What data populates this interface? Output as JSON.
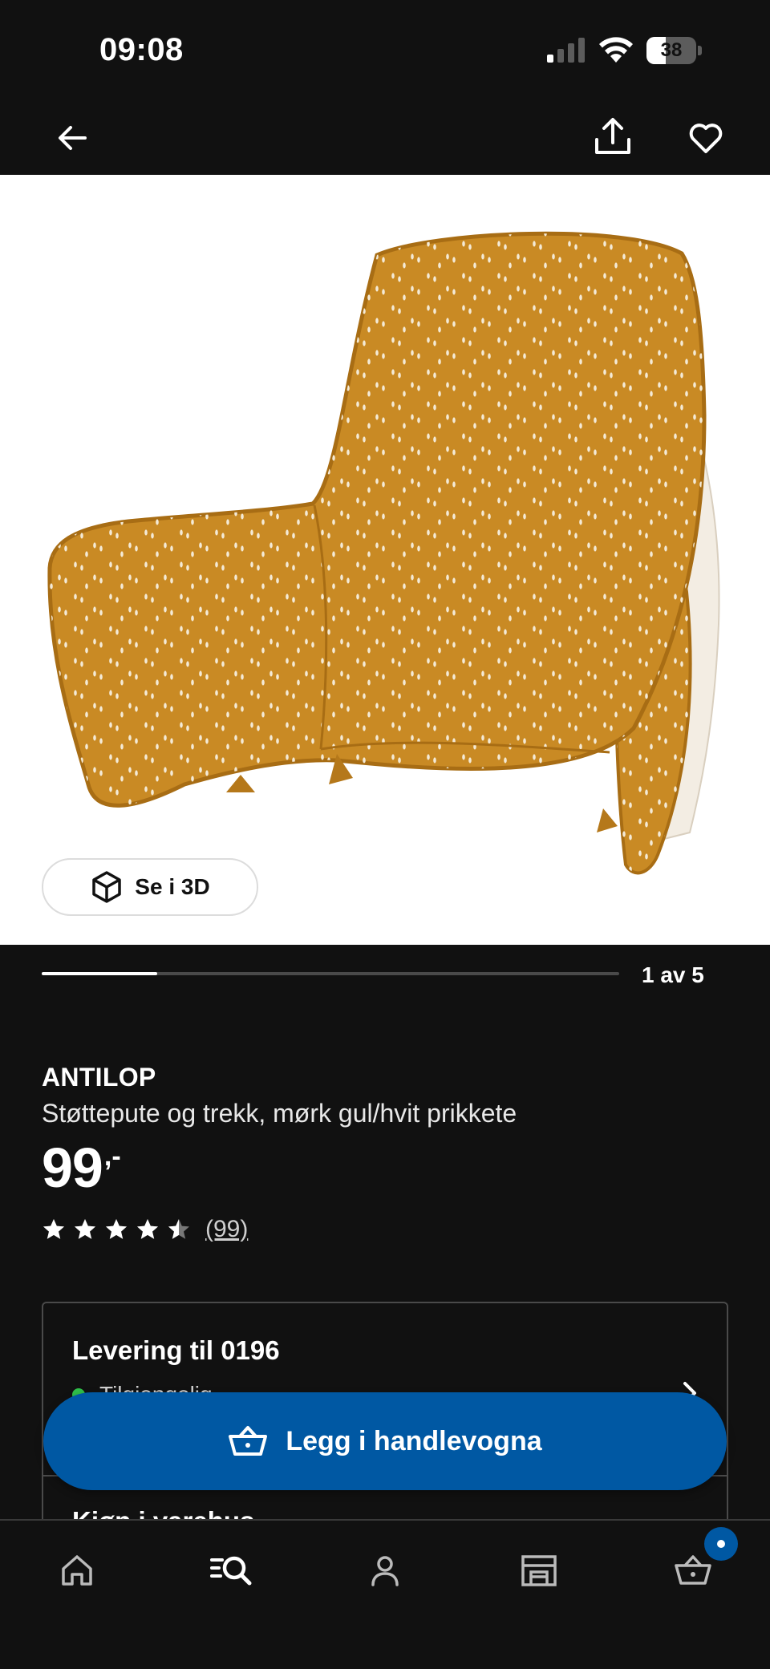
{
  "status_bar": {
    "time": "09:08",
    "battery_text": "38",
    "battery_level": 0.38
  },
  "top_nav": {
    "back_icon": "arrow-left-icon",
    "share_icon": "share-icon",
    "favorite_icon": "heart-outline-icon"
  },
  "gallery": {
    "view_3d_label": "Se i 3D",
    "view_3d_icon": "cube-icon",
    "counter": "1 av 5",
    "current": 1,
    "total": 5
  },
  "product": {
    "name": "ANTILOP",
    "description": "Støttepute og trekk, mørk gul/hvit prikkete",
    "price": "99",
    "price_suffix": ",-",
    "rating": 4.5,
    "rating_max": 5,
    "review_count": "(99)",
    "image_colors": {
      "fabric": "#c98a24",
      "lining": "#f3ede3"
    }
  },
  "delivery": {
    "title": "Levering til 0196",
    "status": "Tilgjengelig",
    "status_color": "#2fbf4a",
    "store_title": "Kjøp i varehus"
  },
  "cta": {
    "label": "Legg i handlevogna",
    "icon": "basket-icon",
    "color": "#0058a3"
  },
  "tab_bar": {
    "items": [
      {
        "name": "home",
        "icon": "home-icon"
      },
      {
        "name": "search",
        "icon": "search-icon"
      },
      {
        "name": "profile",
        "icon": "person-icon"
      },
      {
        "name": "store",
        "icon": "store-icon"
      },
      {
        "name": "cart",
        "icon": "basket-icon"
      }
    ]
  }
}
